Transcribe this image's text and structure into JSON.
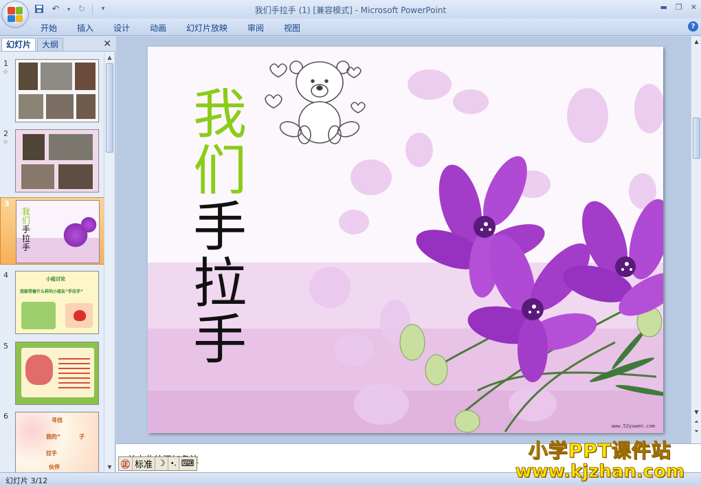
{
  "window": {
    "title": "我们手拉手 (1) [兼容模式] - Microsoft PowerPoint"
  },
  "ribbon": {
    "tabs": [
      "开始",
      "插入",
      "设计",
      "动画",
      "幻灯片放映",
      "审阅",
      "视图"
    ],
    "help_label": "?"
  },
  "left_pane": {
    "tabs": [
      "幻灯片",
      "大纲"
    ],
    "close_label": "✕",
    "slides": [
      {
        "number": "1",
        "anim": "☆"
      },
      {
        "number": "2",
        "anim": "☆"
      },
      {
        "number": "3",
        "anim": ""
      },
      {
        "number": "4",
        "anim": ""
      },
      {
        "number": "5",
        "anim": ""
      },
      {
        "number": "6",
        "anim": ""
      }
    ],
    "selected_index": 2,
    "thumb4_text": {
      "line1": "小组讨论",
      "line2": "我能带着什么样的小朋友“手拉手”"
    },
    "thumb6_text": [
      "寻找",
      "我的“",
      "子",
      "拉手",
      "伙伴"
    ]
  },
  "slide": {
    "title_green": [
      "我",
      "们"
    ],
    "title_black": [
      "手",
      "拉",
      "手"
    ],
    "website": "www.52yuwen.com",
    "colors": {
      "green": "#8bcc18",
      "black": "#111111",
      "petal": "#e6c6ec",
      "flower": "#a43ccd"
    }
  },
  "notes": {
    "placeholder": "单击此处添加备注"
  },
  "statusbar": {
    "slide_info": "幻灯片 3/12"
  },
  "ime": {
    "logo": "㊣",
    "mode": "标准",
    "moon": "☽",
    "punct": "•,",
    "keyboard": "⌨"
  },
  "watermark": {
    "line1": "小学PPT课件站",
    "line2": "www.kjzhan.com"
  }
}
